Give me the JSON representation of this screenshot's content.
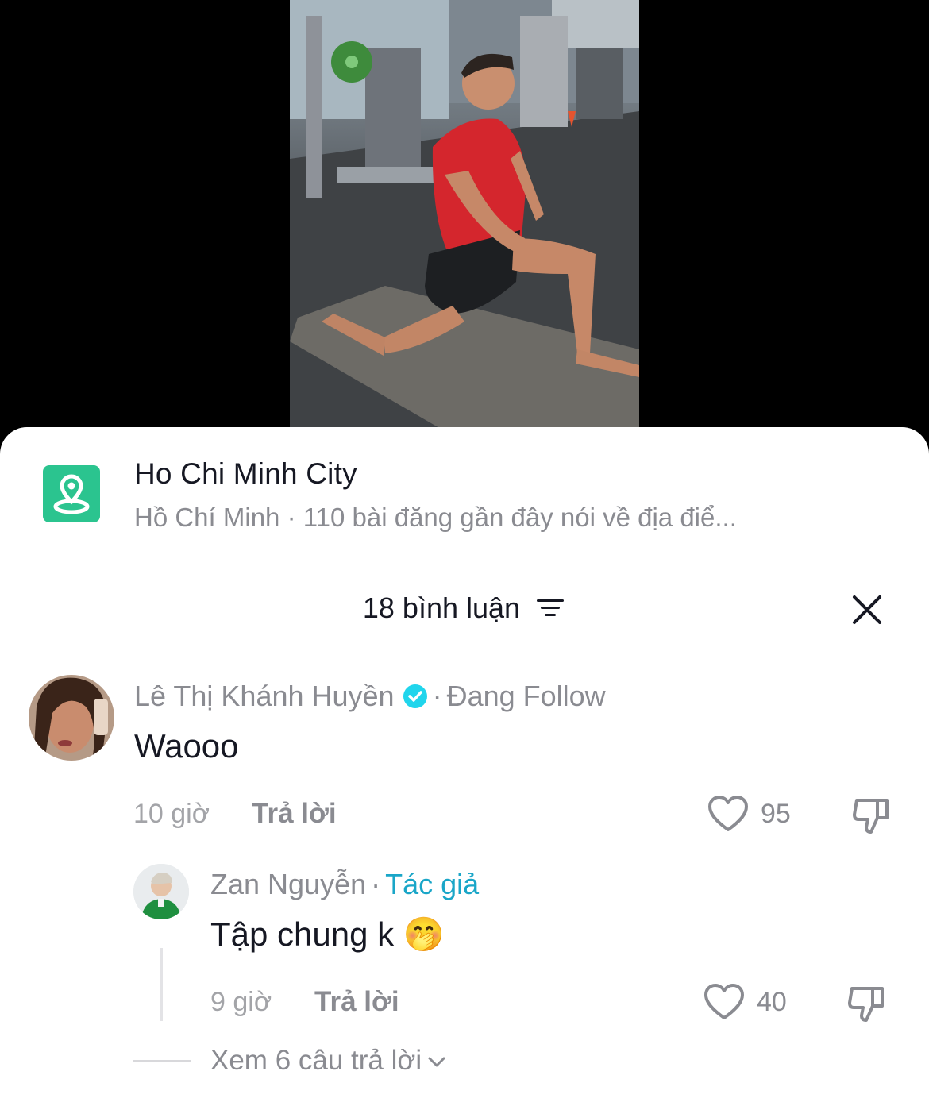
{
  "location": {
    "icon": "location-pin-icon",
    "title": "Ho Chi Minh City",
    "subtitle": "Hồ Chí Minh · 110 bài đăng gần đây nói về địa điể..."
  },
  "comments_header": {
    "count_label": "18 bình luận",
    "sort_icon": "sort-filter-icon",
    "close_icon": "close-icon"
  },
  "comments": [
    {
      "author": "Lê Thị Khánh Huyền",
      "verified": true,
      "separator": "·",
      "status": "Đang Follow",
      "text": "Waooo",
      "time": "10 giờ",
      "reply_label": "Trả lời",
      "likes": "95"
    }
  ],
  "reply": {
    "author": "Zan Nguyễn",
    "separator": "·",
    "author_tag": "Tác giả",
    "text": "Tập chung k 🤭",
    "time": "9 giờ",
    "reply_label": "Trả lời",
    "likes": "40"
  },
  "view_replies_label": "Xem 6 câu trả lời",
  "colors": {
    "location_green": "#2bc48f",
    "author_tag": "#1aa6c8",
    "verified_badge": "#20d5ec"
  }
}
